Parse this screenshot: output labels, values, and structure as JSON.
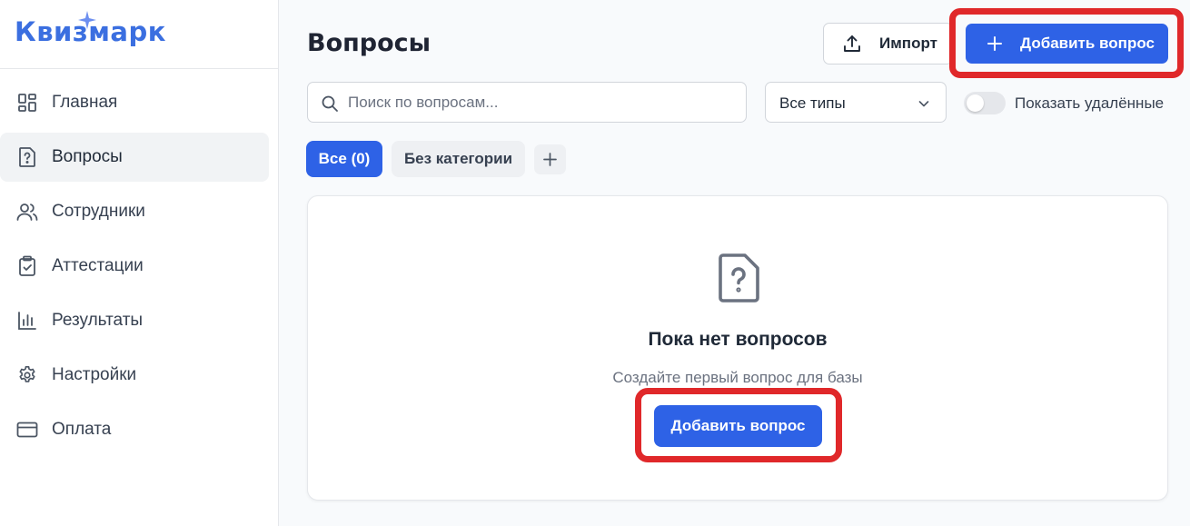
{
  "app": {
    "logo_text": "Квизмарк",
    "accent_color": "#2e62e6",
    "highlight_color": "#e0282a"
  },
  "sidebar": {
    "items": [
      {
        "label": "Главная",
        "icon": "dashboard-grid-icon",
        "active": false
      },
      {
        "label": "Вопросы",
        "icon": "question-file-icon",
        "active": true
      },
      {
        "label": "Сотрудники",
        "icon": "users-icon",
        "active": false
      },
      {
        "label": "Аттестации",
        "icon": "clipboard-check-icon",
        "active": false
      },
      {
        "label": "Результаты",
        "icon": "bar-chart-icon",
        "active": false
      },
      {
        "label": "Настройки",
        "icon": "gear-icon",
        "active": false
      },
      {
        "label": "Оплата",
        "icon": "credit-card-icon",
        "active": false
      }
    ]
  },
  "header": {
    "title": "Вопросы",
    "import_label": "Импорт",
    "add_label": "Добавить вопрос"
  },
  "filters": {
    "search_placeholder": "Поиск по вопросам...",
    "type_select": "Все типы",
    "show_deleted_label": "Показать удалённые",
    "show_deleted": false
  },
  "tabs": [
    {
      "label": "Все (0)",
      "active": true
    },
    {
      "label": "Без категории",
      "active": false
    }
  ],
  "empty_state": {
    "icon": "question-file-icon",
    "title": "Пока нет вопросов",
    "subtitle": "Создайте первый вопрос для базы",
    "button_label": "Добавить вопрос"
  }
}
